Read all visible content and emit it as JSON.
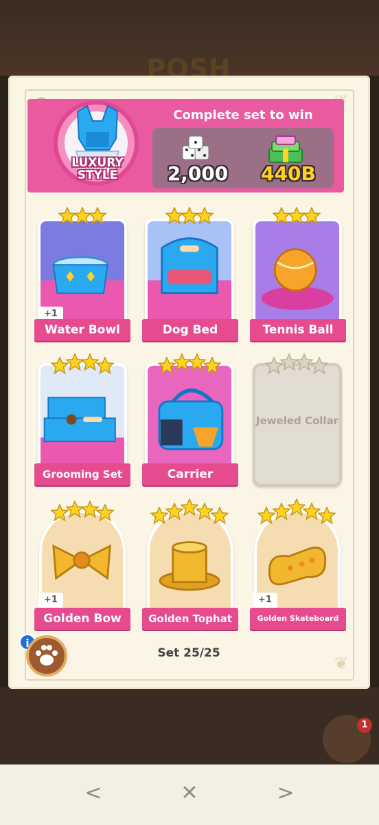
{
  "background": {
    "title": "POSH",
    "cards_badge": "1"
  },
  "header": {
    "set_name": "LUXURY STYLE",
    "reward_title": "Complete set to win",
    "rewards": {
      "dice": "2,000",
      "cash": "440B"
    }
  },
  "cards": [
    {
      "name": "Water Bowl",
      "stars": 3,
      "plus": "+1",
      "collected": true
    },
    {
      "name": "Dog Bed",
      "stars": 3,
      "plus": "",
      "collected": true
    },
    {
      "name": "Tennis Ball",
      "stars": 3,
      "plus": "",
      "collected": true
    },
    {
      "name": "Grooming Set",
      "stars": 4,
      "plus": "",
      "collected": true
    },
    {
      "name": "Carrier",
      "stars": 4,
      "plus": "",
      "collected": true
    },
    {
      "name": "Jeweled Collar",
      "stars": 4,
      "plus": "",
      "collected": false
    },
    {
      "name": "Golden Bow",
      "stars": 4,
      "plus": "+1",
      "collected": true
    },
    {
      "name": "Golden Tophat",
      "stars": 5,
      "plus": "",
      "collected": true
    },
    {
      "name": "Golden Skateboard",
      "stars": 5,
      "plus": "+1",
      "collected": true
    }
  ],
  "footer": {
    "set_progress": "Set 25/25",
    "info_label": "i"
  },
  "nav": {
    "prev": "<",
    "close": "✕",
    "next": ">"
  },
  "colors": {
    "accent_pink": "#ea5aa0",
    "ribbon_pink": "#e64b8f",
    "gold_star": "#ffd21f",
    "cash_yellow": "#ffd21f"
  }
}
